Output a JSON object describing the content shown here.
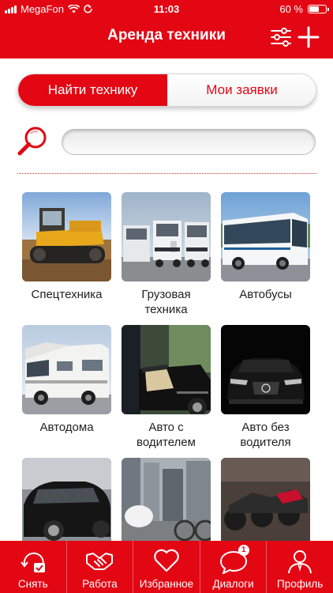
{
  "status_bar": {
    "carrier": "MegaFon",
    "time": "11:03",
    "battery": "60 %"
  },
  "header": {
    "title": "Аренда техники"
  },
  "segments": {
    "find": "Найти технику",
    "requests": "Мои заявки"
  },
  "search": {
    "placeholder": "",
    "value": ""
  },
  "categories": [
    {
      "label": "Спецтехника"
    },
    {
      "label": "Грузовая\nтехника"
    },
    {
      "label": "Автобусы"
    },
    {
      "label": "Автодома"
    },
    {
      "label": "Авто с\nводителем"
    },
    {
      "label": "Авто без\nводителя"
    },
    {
      "label": ""
    },
    {
      "label": ""
    },
    {
      "label": ""
    }
  ],
  "tabbar": {
    "items": [
      {
        "label": "Снять"
      },
      {
        "label": "Работа"
      },
      {
        "label": "Избранное"
      },
      {
        "label": "Диалоги",
        "badge": "1"
      },
      {
        "label": "Профиль"
      }
    ]
  },
  "colors": {
    "brand": "#e30613",
    "text": "#222222",
    "background": "#ffffff"
  },
  "icons": {
    "status": [
      "signal-icon",
      "wifi-icon",
      "location-icon",
      "battery-icon"
    ],
    "header": [
      "filter-icon",
      "add-icon"
    ],
    "search": "search-icon",
    "tabs": [
      "camera-check-icon",
      "handshake-icon",
      "heart-icon",
      "chat-bubble-icon",
      "user-icon"
    ]
  }
}
